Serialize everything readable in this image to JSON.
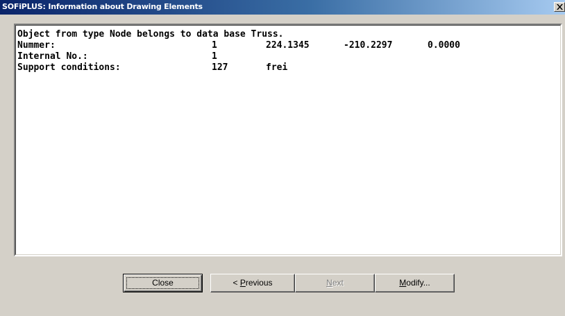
{
  "window": {
    "title": "SOFiPLUS: Information about Drawing Elements"
  },
  "info": {
    "lines": [
      {
        "text": "Object from type Node belongs to data base Truss."
      },
      {
        "label": "Nummer:",
        "values": [
          "1",
          "224.1345",
          "-210.2297",
          "0.0000"
        ]
      },
      {
        "label": "Internal No.:",
        "values": [
          "1"
        ]
      },
      {
        "label": "Support conditions:",
        "values": [
          "127",
          "frei"
        ]
      }
    ]
  },
  "buttons": {
    "close": {
      "label": "Close"
    },
    "previous": {
      "prefix": "< ",
      "mnemonic": "P",
      "rest": "revious"
    },
    "next": {
      "mnemonic": "N",
      "rest": "ext"
    },
    "modify": {
      "mnemonic": "M",
      "rest": "odify..."
    }
  },
  "icons": {
    "close": "close-icon"
  }
}
